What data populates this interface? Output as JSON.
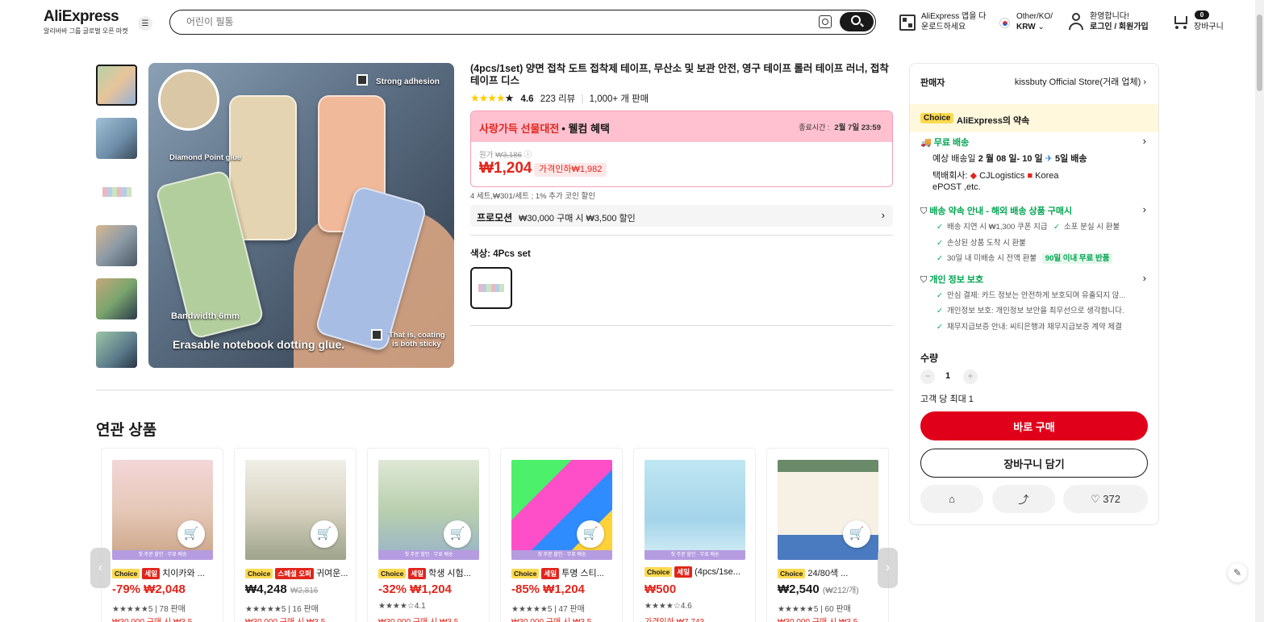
{
  "header": {
    "logo": "AliExpress",
    "logo_sub": "알리바바 그룹 글로벌 오픈 마켓",
    "search_placeholder": "어린이 필통",
    "app_download_line1": "AliExpress 앱을 다",
    "app_download_line2": "운로드하세요",
    "locale_line1": "Other/KO/",
    "currency": "KRW",
    "greeting": "환영합니다!",
    "login": "로그인 / 회원가입",
    "cart_count": "0",
    "cart_label": "장바구니"
  },
  "gallery": {
    "image_texts": [
      "Strong adhesion",
      "Diamond Point glue",
      "Bandwidth 6mm",
      "Erasable notebook dotting glue.",
      "That is, coating",
      "is both sticky"
    ]
  },
  "product": {
    "title": "(4pcs/1set) 양면 접착 도트 접착제 테이프, 무산소 및 보관 안전, 영구 테이프 롤러 테이프 러너, 접착 테이프 디스",
    "rating": "4.6",
    "reviews": "223 리뷰",
    "sold": "1,000+ 개 판매",
    "sale_event": "사랑가득 선물대전",
    "welcome": "• 웰컴 혜택",
    "ends_label": "종료시간 :",
    "ends_time": "2월 7일 23:59",
    "orig_label": "원가",
    "orig_price": "₩3,186",
    "price": "₩1,204",
    "discount": "가격인하₩1,982",
    "per_unit": "4 세트,₩301/세트 ; 1% 추가 코인 할인",
    "promo_label": "프로모션",
    "promo_text": "₩30,000 구매 시 ₩3,500 할인",
    "color_label": "색상:",
    "color_value": "4Pcs set"
  },
  "side": {
    "seller_label": "판매자",
    "seller_name": "kissbuty Official Store(거래 업체)",
    "choice_tag": "Choice",
    "choice_promise": "AliExpress의 약속",
    "free_shipping": "무료 배송",
    "delivery_prefix": "예상 배송일 ",
    "delivery_dates": "2 월 08 일- 10 일",
    "delivery_days": "5일 배송",
    "carrier_label": "택배회사:",
    "carrier1": "CJLogistics",
    "carrier2": "Korea",
    "carrier3": "ePOST ,etc.",
    "guarantee_title": "배송 약속 안내 - 해외 배송 상품 구매시",
    "guarantee_1": "배송 지연 시 ₩1,300 쿠폰 지급",
    "guarantee_2": "소포 분실 시 환불",
    "guarantee_3": "손상된 상품 도착 시 환불",
    "guarantee_4": "30일 내 미배송 시 전액 환불",
    "guarantee_badge": "90일 이내 무료 반품",
    "privacy_title": "개인 정보 보호",
    "privacy_1": "안심 결제: 카드 정보는 안전하게 보호되며 유출되지 않...",
    "privacy_2": "개인정보 보호: 개인정보 보안을 최우선으로 생각합니다.",
    "privacy_3": "채무지급보증 안내: 씨티은행과 채무지급보증 계약 체결",
    "qty_label": "수량",
    "qty_value": "1",
    "qty_minus": "−",
    "qty_plus": "+",
    "max_per": "고객 당 최대 1",
    "buy_now": "바로 구매",
    "add_cart": "장바구니 담기",
    "wish_count": "372"
  },
  "related": {
    "title": "연관 상품",
    "strip_text": "첫 주문 할인 · 무료 배송",
    "items": [
      {
        "tags": [
          "Choice",
          "세일"
        ],
        "name": "치이카와 ...",
        "price": "-79% ₩2,048",
        "orig": "",
        "rating": "★★★★★5",
        "sold": "78 판매",
        "promo": "₩30,000 구매 시 ₩3,5"
      },
      {
        "tags": [
          "Choice",
          "스페셜 오퍼"
        ],
        "name": "귀여운...",
        "price": "₩4,248",
        "orig": "₩2,816",
        "rating": "★★★★★5",
        "sold": "16 판매",
        "promo": "₩30,000 구매 시 ₩3,5"
      },
      {
        "tags": [
          "Choice",
          "세일"
        ],
        "name": "학생 시험...",
        "price": "-32% ₩1,204",
        "orig": "",
        "rating": "★★★★☆4.1",
        "sold": "",
        "promo": "₩30,000 구매 시 ₩3,5"
      },
      {
        "tags": [
          "Choice",
          "세일"
        ],
        "name": "투명 스티...",
        "price": "-85% ₩1,204",
        "orig": "",
        "rating": "★★★★★5",
        "sold": "47 판매",
        "promo": "₩30,000 구매 시 ₩3,5"
      },
      {
        "tags": [
          "Choice",
          "세일"
        ],
        "name": "(4pcs/1se...",
        "price": "₩500",
        "orig": "",
        "rating": "★★★★☆4.6",
        "sold": "",
        "promo": "가격인하 ₩7,743"
      },
      {
        "tags": [
          "Choice"
        ],
        "name": "24/80색 ...",
        "price": "₩2,540",
        "orig": "(₩212/개)",
        "rating": "★★★★★5",
        "sold": "60 판매",
        "promo": "₩30,000 구매 시 ₩3,5"
      }
    ]
  },
  "colors": {
    "accent_red": "#e1251b",
    "choice_yellow": "#fcd94f",
    "green": "#00a650"
  }
}
